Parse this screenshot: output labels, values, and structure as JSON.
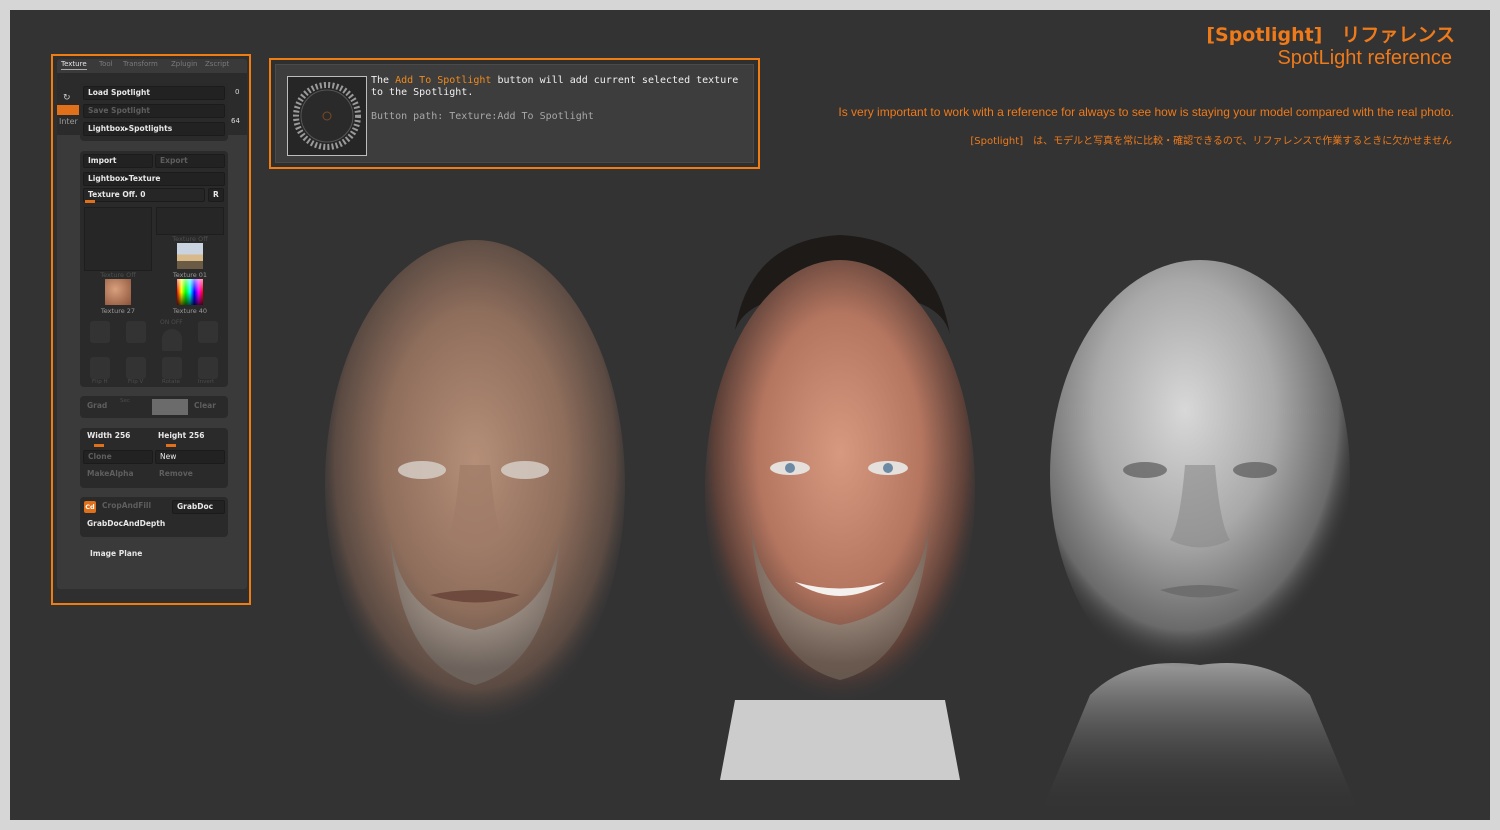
{
  "palette": {
    "tabs": [
      "Texture",
      "Tool",
      "Transform",
      "Zplugin",
      "Zscript"
    ],
    "side_text": "Inter",
    "side_numbers": [
      "0",
      "64"
    ],
    "buttons": {
      "load_spotlight": "Load Spotlight",
      "save_spotlight": "Save Spotlight",
      "lightbox_spotlights": "Lightbox▸Spotlights",
      "import": "Import",
      "export": "Export",
      "lightbox_texture": "Lightbox▸Texture",
      "texture_slider": "Texture Off. 0",
      "r_button": "R",
      "grad": "Grad",
      "sec": "Sec",
      "clear": "Clear",
      "width": "Width 256",
      "height": "Height 256",
      "clone": "Clone",
      "new": "New",
      "make_alpha": "MakeAlpha",
      "remove": "Remove",
      "cd": "Cd",
      "crop_and_fill": "CropAndFill",
      "grab_doc": "GrabDoc",
      "grab_doc_and_depth": "GrabDocAndDepth",
      "image_plane": "Image Plane"
    },
    "textures": [
      "Texture Off",
      "Texture Off",
      "Texture 01",
      "Texture 27",
      "Texture 40"
    ],
    "ghost_labels": [
      "Flip H",
      "Flip V",
      "Rotate",
      "Invert"
    ],
    "on_off": "ON  OFF"
  },
  "tooltip": {
    "text_pre": "The ",
    "text_highlight": "Add To Spotlight",
    "text_post": " button will add current selected texture to the Spotlight.",
    "path": "Button path: Texture:Add To Spotlight"
  },
  "heading": {
    "title_jp": "[Spotlight]　リファレンス",
    "title_en": "SpotLight reference",
    "desc_en": "Is very important to work with a reference for always to see how is staying your model compared with the real photo.",
    "desc_jp": "[Spotlight]　は、モデルと写真を常に比較・確認できるので、リファレンスで作業するときに欠かせません"
  },
  "colors": {
    "accent": "#ee7a1a",
    "background": "#333334"
  }
}
